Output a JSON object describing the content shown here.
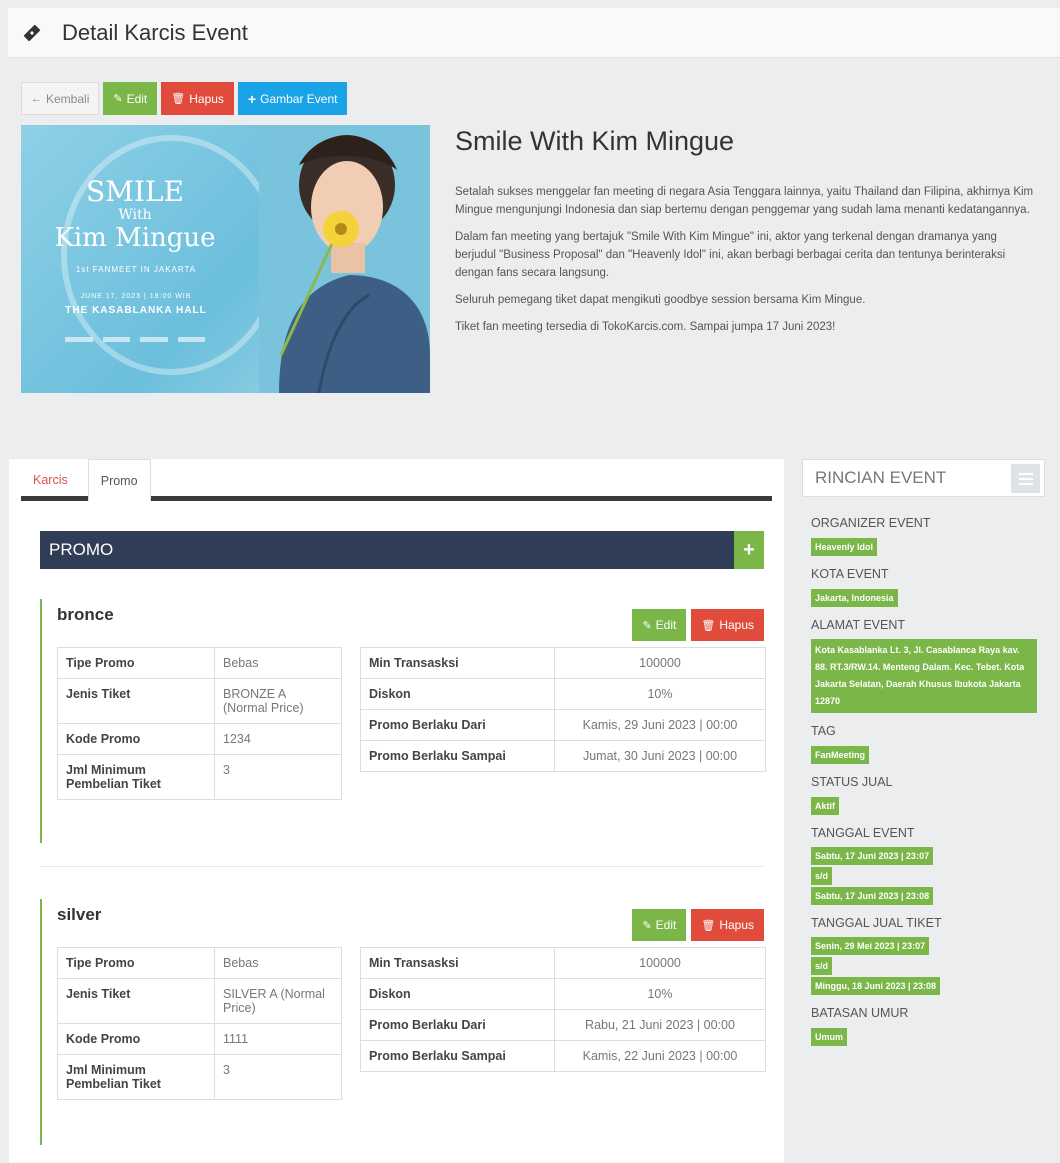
{
  "header": {
    "title": "Detail Karcis Event",
    "icon": "ticket-icon"
  },
  "toolbar": {
    "back_label": "Kembali",
    "edit_label": "Edit",
    "delete_label": "Hapus",
    "add_image_label": "Gambar Event"
  },
  "poster": {
    "line1": "SMILE",
    "line2": "With",
    "line3": "Kim Mingue",
    "subtitle": "1st FANMEET IN JAKARTA",
    "date": "JUNE 17, 2023 | 18:00 WIB",
    "venue": "THE KASABLANKA HALL"
  },
  "event": {
    "title": "Smile With Kim Mingue",
    "paragraphs": [
      "Setalah sukses menggelar fan meeting di negara Asia Tenggara lainnya, yaitu Thailand dan Filipina, akhirnya Kim Mingue mengunjungi Indonesia dan siap bertemu dengan penggemar yang sudah lama menanti kedatangannya.",
      "Dalam fan meeting yang bertajuk \"Smile With Kim Mingue\" ini, aktor yang terkenal dengan dramanya yang berjudul \"Business Proposal\" dan \"Heavenly Idol\" ini, akan berbagi berbagai cerita dan tentunya berinteraksi dengan fans secara langsung.",
      "Seluruh pemegang tiket dapat mengikuti goodbye session bersama Kim Mingue.",
      "Tiket fan meeting tersedia di TokoKarcis.com. Sampai jumpa 17 Juni 2023!"
    ]
  },
  "tabs": {
    "karcis": "Karcis",
    "promo": "Promo"
  },
  "promo_header": "PROMO",
  "promo_actions": {
    "edit": "Edit",
    "delete": "Hapus"
  },
  "labels": {
    "tipe": "Tipe Promo",
    "jenis": "Jenis Tiket",
    "kode": "Kode Promo",
    "jml": "Jml Minimum Pembelian Tiket",
    "min": "Min Transasksi",
    "diskon": "Diskon",
    "dari": "Promo Berlaku Dari",
    "sampai": "Promo Berlaku Sampai"
  },
  "promos": [
    {
      "name": "bronce",
      "tipe": "Bebas",
      "jenis": "BRONZE A (Normal Price)",
      "kode": "1234",
      "jml": "3",
      "min": "100000",
      "diskon": "10%",
      "dari": "Kamis, 29 Juni 2023 | 00:00",
      "sampai": "Jumat, 30 Juni 2023 | 00:00"
    },
    {
      "name": "silver",
      "tipe": "Bebas",
      "jenis": "SILVER A (Normal Price)",
      "kode": "1111",
      "jml": "3",
      "min": "100000",
      "diskon": "10%",
      "dari": "Rabu, 21 Juni 2023 | 00:00",
      "sampai": "Kamis, 22 Juni 2023 | 00:00"
    }
  ],
  "sidebar": {
    "title": "RINCIAN EVENT",
    "organizer_label": "ORGANIZER EVENT",
    "organizer": "Heavenly Idol",
    "kota_label": "KOTA EVENT",
    "kota": "Jakarta, Indonesia",
    "alamat_label": "ALAMAT EVENT",
    "alamat": "Kota Kasablanka Lt. 3, Jl. Casablanca Raya kav. 88. RT.3/RW.14. Menteng Dalam. Kec. Tebet. Kota Jakarta Selatan, Daerah Khusus Ibukota Jakarta 12870",
    "tag_label": "TAG",
    "tag": "FanMeeting",
    "status_label": "STATUS JUAL",
    "status": "Aktif",
    "tanggal_label": "TANGGAL EVENT",
    "tanggal_start": "Sabtu, 17 Juni 2023 | 23:07",
    "sd": "s/d",
    "tanggal_end": "Sabtu, 17 Juni 2023 | 23:08",
    "jual_label": "TANGGAL JUAL TIKET",
    "jual_start": "Senin, 29 Mei 2023 | 23:07",
    "jual_end": "Minggu, 18 Juni 2023 | 23:08",
    "umur_label": "BATASAN UMUR",
    "umur": "Umum"
  },
  "colors": {
    "success": "#7ab648",
    "danger": "#e04b3c",
    "info": "#1aa3e6",
    "navy": "#2f3e56"
  }
}
